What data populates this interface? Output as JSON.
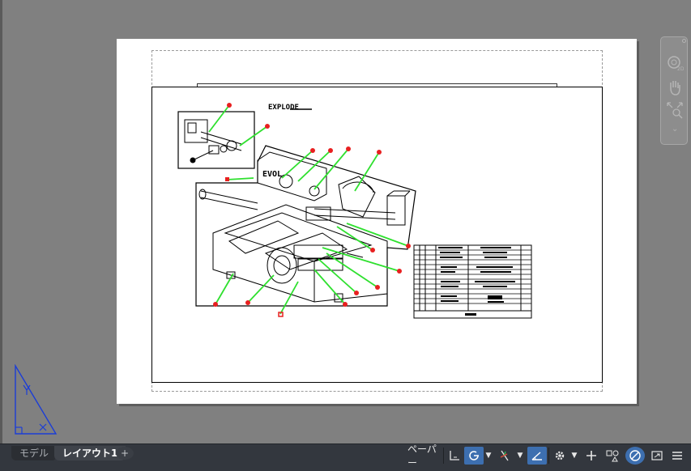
{
  "layout_tabs": [
    {
      "label": "モデル",
      "active": false
    },
    {
      "label": "レイアウト1",
      "active": true
    }
  ],
  "add_tab_label": "+",
  "status_bar": {
    "space_label": "ペーパー",
    "icons": [
      "snap-grid-icon",
      "ortho-icon",
      "polar-tracking-icon",
      "isometric-icon",
      "object-snap-icon",
      "workspace-gear-icon",
      "plus-icon",
      "annotation-scale-icon",
      "isolate-objects-icon",
      "fullscreen-icon",
      "customization-menu-icon"
    ]
  },
  "drawing_text": {
    "title_callout": "EXPLODE"
  },
  "colors": {
    "canvas_bg": "#808080",
    "paper": "#ffffff",
    "leader": "#2fe02f",
    "balloon": "#e82020",
    "statusbar_bg": "#33373e",
    "active_blue": "#3d6fb0",
    "ucs_blue": "#1b3dd6"
  },
  "navbar_icons": [
    "steeringwheel-2d-icon",
    "pan-hand-icon",
    "zoom-extents-icon"
  ]
}
